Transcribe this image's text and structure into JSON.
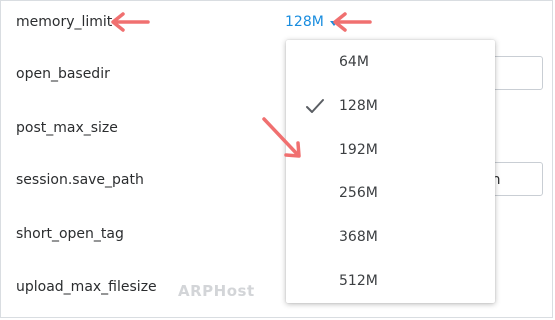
{
  "settings": {
    "labels": [
      "memory_limit",
      "open_basedir",
      "post_max_size",
      "session.save_path",
      "short_open_tag",
      "upload_max_filesize"
    ],
    "memory_limit_value": "128M",
    "session_save_path_fragment": "on"
  },
  "dropdown": {
    "options": [
      "64M",
      "128M",
      "192M",
      "256M",
      "368M",
      "512M"
    ],
    "selected": "128M"
  },
  "watermark": {
    "text": "ARPHost"
  },
  "colors": {
    "accent_blue": "#1a8ddf",
    "annotation_red": "#f07070",
    "check_gray": "#5a5e63"
  },
  "icons": {
    "selected_marker": "checkmark-icon",
    "trigger_marker": "caret-down-icon",
    "annotations": "arrow-icon"
  }
}
